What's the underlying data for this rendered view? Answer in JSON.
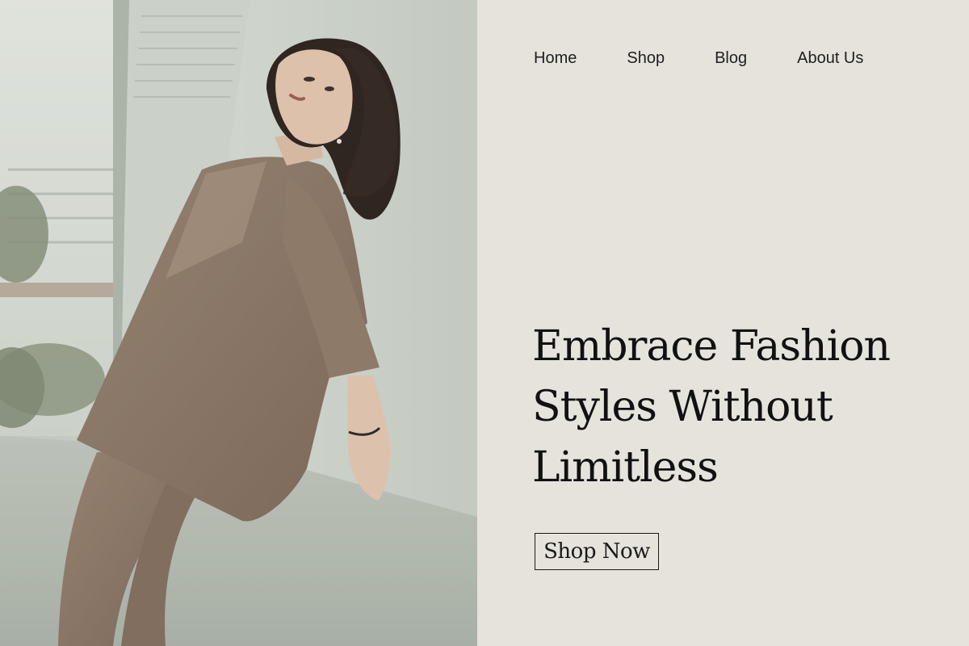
{
  "nav": {
    "items": [
      {
        "label": "Home"
      },
      {
        "label": "Shop"
      },
      {
        "label": "Blog"
      },
      {
        "label": "About Us"
      }
    ]
  },
  "hero": {
    "title_lines": [
      "Embrace Fashion",
      "Styles Without",
      "Limitless"
    ],
    "cta_label": "Shop Now"
  },
  "colors": {
    "background": "#e6e3dd",
    "text": "#111111",
    "outfit": "#8a7565"
  }
}
